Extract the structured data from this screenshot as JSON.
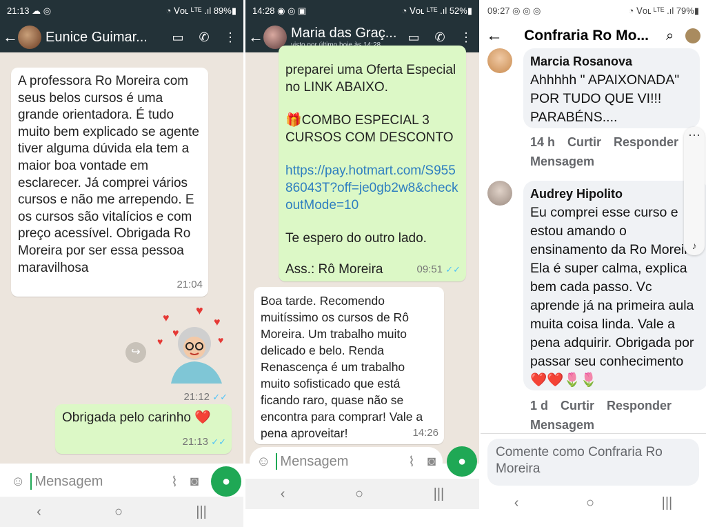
{
  "panel1": {
    "status_time": "21:13 ☁ ◎",
    "status_right": "◔ ᐯᴏʟ ᴸᵀᴱ .ıl 89%▮",
    "contact_name": "Eunice Guimar...",
    "msg1": "A professora Ro Moreira com seus belos cursos é uma grande orientadora.  É tudo muito bem explicado se agente tiver alguma dúvida  ela tem a maior boa vontade em  esclarecer. Já comprei vários cursos e não me arrependo. E os cursos são vitalícios  e com preço acessível.  Obrigada Ro Moreira por  ser essa pessoa maravilhosa",
    "msg1_time": "21:04",
    "sticker_time": "21:12",
    "msg2": "Obrigada pelo carinho ❤️",
    "msg2_time": "21:13",
    "input_placeholder": "Mensagem"
  },
  "panel2": {
    "status_time": "14:28 ◉ ◎ ▣",
    "status_right": "◔ ᐯᴏʟ ᴸᵀᴱ .ıl 52%▮",
    "contact_name": "Maria das Graç...",
    "last_seen": "visto por último hoje às 14:28",
    "msg1_intro": "preparei uma Oferta Especial no LINK ABAIXO.",
    "msg1_combo": "🎁COMBO ESPECIAL 3 CURSOS COM DESCONTO",
    "msg1_link": "https://pay.hotmart.com/S95586043T?off=je0gb2w8&checkoutMode=10",
    "msg1_bye": "Te espero do outro lado.",
    "msg1_sign": "Ass.: Rô Moreira",
    "msg1_time": "09:51",
    "msg2": "Boa tarde. Recomendo muitíssimo os cursos de Rô Moreira. Um trabalho muito delicado e belo. Renda Renascença é um trabalho muito sofisticado que está ficando raro, quase não se encontra para comprar! Vale a pena aproveitar!",
    "msg2_time": "14:26",
    "input_placeholder": "Mensagem"
  },
  "panel3": {
    "status_time": "09:27 ◎ ◎ ◎",
    "status_right": "◔ ᐯᴏʟ ᴸᵀᴱ .ıl 79%▮",
    "title": "Confraria Ro Mo...",
    "c1_author": "Marcia Rosanova",
    "c1_text": "Ahhhhh   \" APAIXONADA\" POR TUDO QUE VI!!! PARABÉNS....",
    "c1_time": "14 h",
    "c2_author": "Audrey Hipolito",
    "c2_text": "Eu comprei esse curso e estou amando o ensinamento da Ro Moreira. Ela é super calma, explica bem cada passo. Vc aprende já na primeira aula muita coisa linda. Vale a pena adquirir. Obrigada por passar seu conhecimento ❤️❤️🌷🌷",
    "c2_time": "1 d",
    "action_like": "Curtir",
    "action_reply": "Responder",
    "action_message": "Mensagem",
    "input_placeholder": "Comente como Confraria Ro Moreira"
  }
}
